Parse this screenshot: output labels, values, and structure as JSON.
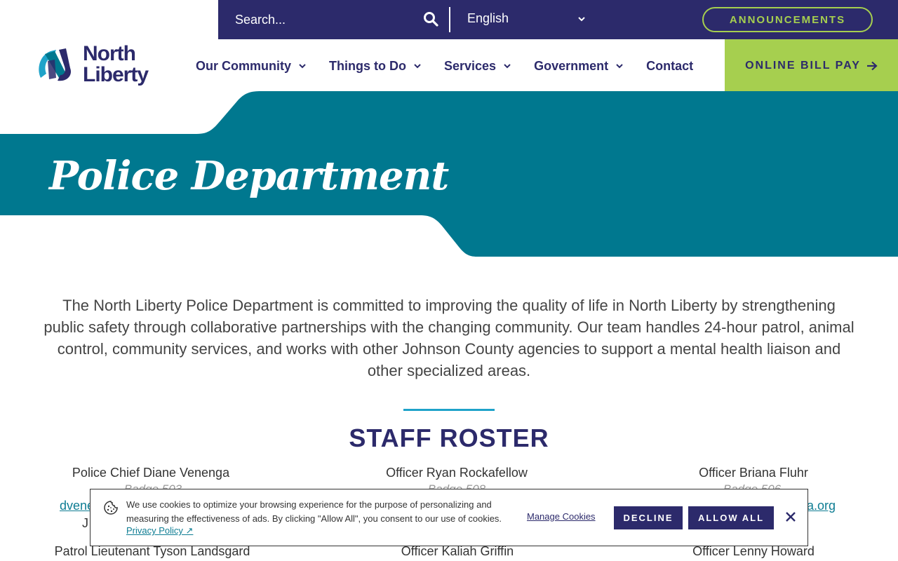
{
  "utility_bar": {
    "search_placeholder": "Search...",
    "language": "English",
    "announcements_label": "ANNOUNCEMENTS"
  },
  "header": {
    "logo_line1": "North",
    "logo_line2": "Liberty",
    "nav": [
      {
        "label": "Our Community",
        "has_dropdown": true
      },
      {
        "label": "Things to Do",
        "has_dropdown": true
      },
      {
        "label": "Services",
        "has_dropdown": true
      },
      {
        "label": "Government",
        "has_dropdown": true
      },
      {
        "label": "Contact",
        "has_dropdown": false
      }
    ],
    "bill_pay_label": "ONLINE BILL PAY"
  },
  "hero": {
    "title": "Police Department"
  },
  "intro": {
    "text": "The North Liberty Police Department is committed to improving the quality of life in North Liberty by strengthening public safety through collaborative partnerships with the changing community. Our team handles 24-hour patrol, animal control, community services, and works with other Johnson County agencies to support a mental health liaison and other specialized areas."
  },
  "roster": {
    "heading": "STAFF ROSTER",
    "row1": [
      {
        "name": "Police Chief Diane Venenga",
        "badge_partial": "Badge 503",
        "email_partial": "dvene",
        "extra_partial": "J"
      },
      {
        "name": "Officer Ryan Rockafellow",
        "badge_partial": "Badge 508"
      },
      {
        "name": "Officer Briana Fluhr",
        "badge_partial": "Badge 506",
        "email_partial": "a.org"
      }
    ],
    "row2": [
      {
        "name": "Patrol Lieutenant Tyson Landsgard"
      },
      {
        "name": "Officer Kaliah Griffin"
      },
      {
        "name": "Officer Lenny Howard"
      }
    ]
  },
  "cookie_banner": {
    "text": "We use cookies to optimize your browsing experience for the purpose of personalizing and measuring the effectiveness of ads. By clicking \"Allow All\", you consent to our use of cookies.",
    "privacy_link": "Privacy Policy ↗",
    "manage_link": "Manage Cookies",
    "decline_label": "DECLINE",
    "allow_label": "ALLOW ALL"
  },
  "colors": {
    "navy": "#2c2a6b",
    "teal": "#00788f",
    "lime": "#a6cf4f",
    "accent_blue": "#1fa3c9"
  },
  "icons": [
    "search-icon",
    "chevron-down-icon",
    "arrow-right-icon",
    "cookie-icon",
    "close-icon"
  ]
}
